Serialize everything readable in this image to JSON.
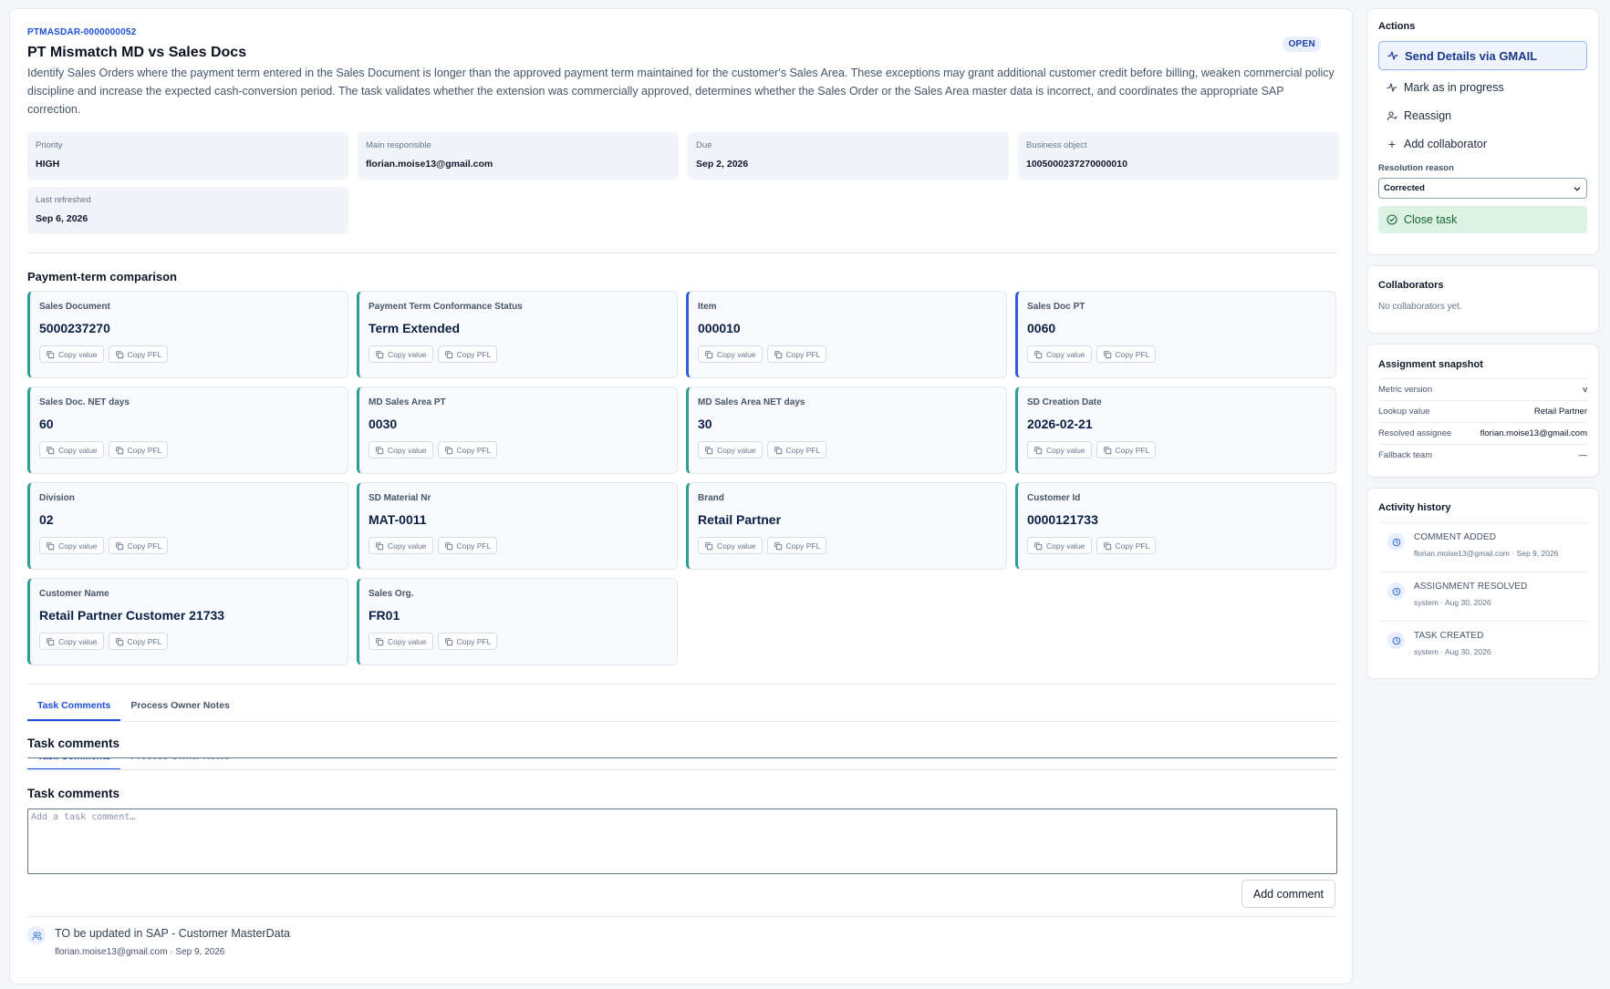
{
  "task": {
    "id": "PTMASDAR-0000000052",
    "title": "PT Mismatch MD vs Sales Docs",
    "status": "OPEN",
    "description": "Identify Sales Orders where the payment term entered in the Sales Document is longer than the approved payment term maintained for the customer's Sales Area. These exceptions may grant additional customer credit before billing, weaken commercial policy discipline and increase the expected cash-conversion period. The task validates whether the extension was commercially approved, determines whether the Sales Order or the Sales Area master data is incorrect, and coordinates the appropriate SAP correction."
  },
  "meta": [
    {
      "label": "Priority",
      "value": "HIGH"
    },
    {
      "label": "Main responsible",
      "value": "florian.moise13@gmail.com"
    },
    {
      "label": "Due",
      "value": "Sep 2, 2026"
    },
    {
      "label": "Business object",
      "value": "1005000237270000010"
    },
    {
      "label": "Last refreshed",
      "value": "Sep 6, 2026"
    }
  ],
  "comparison": {
    "title": "Payment-term comparison",
    "copy_value_label": "Copy value",
    "copy_pfl_label": "Copy PFL",
    "fields": [
      {
        "label": "Sales Document",
        "value": "5000237270",
        "accent": "teal"
      },
      {
        "label": "Payment Term Conformance Status",
        "value": "Term Extended",
        "accent": "teal"
      },
      {
        "label": "Item",
        "value": "000010",
        "accent": "blue"
      },
      {
        "label": "Sales Doc PT",
        "value": "0060",
        "accent": "blue"
      },
      {
        "label": "Sales Doc. NET days",
        "value": "60",
        "accent": "teal"
      },
      {
        "label": "MD Sales Area PT",
        "value": "0030",
        "accent": "teal"
      },
      {
        "label": "MD Sales Area NET days",
        "value": "30",
        "accent": "teal"
      },
      {
        "label": "SD Creation Date",
        "value": "2026-02-21",
        "accent": "teal"
      },
      {
        "label": "Division",
        "value": "02",
        "accent": "teal"
      },
      {
        "label": "SD Material Nr",
        "value": "MAT-0011",
        "accent": "teal"
      },
      {
        "label": "Brand",
        "value": "Retail Partner",
        "accent": "teal"
      },
      {
        "label": "Customer Id",
        "value": "0000121733",
        "accent": "teal"
      },
      {
        "label": "Customer Name",
        "value": "Retail Partner Customer 21733",
        "accent": "teal"
      },
      {
        "label": "Sales Org.",
        "value": "FR01",
        "accent": "teal"
      }
    ]
  },
  "tabs": [
    "Task Comments",
    "Process Owner Notes"
  ],
  "comments": {
    "heading": "Task comments",
    "placeholder": "Add a task comment…",
    "add_label": "Add comment",
    "entries": [
      {
        "text": "TO be updated in SAP - Customer MasterData",
        "meta": "florian.moise13@gmail.com · Sep 9, 2026"
      }
    ]
  },
  "actions": {
    "title": "Actions",
    "send": "Send Details via GMAIL",
    "progress": "Mark as in progress",
    "reassign": "Reassign",
    "collab": "Add collaborator",
    "resolution_label": "Resolution reason",
    "resolution_value": "Corrected",
    "close": "Close task"
  },
  "collaborators": {
    "title": "Collaborators",
    "empty": "No collaborators yet."
  },
  "snapshot": {
    "title": "Assignment snapshot",
    "rows": [
      {
        "label": "Metric version",
        "value": "v"
      },
      {
        "label": "Lookup value",
        "value": "Retail Partner"
      },
      {
        "label": "Resolved assignee",
        "value": "florian.moise13@gmail.com"
      },
      {
        "label": "Fallback team",
        "value": "—"
      }
    ]
  },
  "activity": {
    "title": "Activity history",
    "items": [
      {
        "title": "COMMENT ADDED",
        "meta": "florian.moise13@gmail.com · Sep 9, 2026"
      },
      {
        "title": "ASSIGNMENT RESOLVED",
        "meta": "system · Aug 30, 2026"
      },
      {
        "title": "TASK CREATED",
        "meta": "system · Aug 30, 2026"
      }
    ]
  },
  "colors": {
    "accent": "#1d4ed8",
    "teal": "#2f9d96",
    "success_bg": "#dcf3e3"
  }
}
